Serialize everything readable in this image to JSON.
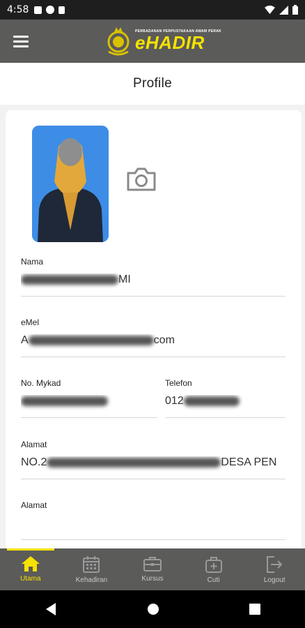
{
  "status": {
    "time": "4:58"
  },
  "header": {
    "app_name": "eHADIR",
    "tagline": "PERBADANAN PERPUSTAKAAN AWAM PERAK"
  },
  "page": {
    "title": "Profile"
  },
  "profile": {
    "fields": {
      "nama": {
        "label": "Nama",
        "value": "MI"
      },
      "emel": {
        "label": "eMel",
        "value": "A",
        "value_end": "com"
      },
      "mykad": {
        "label": "No. Mykad",
        "value": ""
      },
      "telefon": {
        "label": "Telefon",
        "value": "012"
      },
      "alamat1": {
        "label": "Alamat",
        "value": "NO.2",
        "value_end": "DESA PEN"
      },
      "alamat2": {
        "label": "Alamat",
        "value": ""
      }
    }
  },
  "nav": {
    "items": [
      {
        "label": "Utama",
        "icon": "home-icon",
        "active": true
      },
      {
        "label": "Kehadiran",
        "icon": "calendar-icon",
        "active": false
      },
      {
        "label": "Kursus",
        "icon": "briefcase-icon",
        "active": false
      },
      {
        "label": "Cuti",
        "icon": "medical-bag-icon",
        "active": false
      },
      {
        "label": "Logout",
        "icon": "logout-icon",
        "active": false
      }
    ]
  },
  "colors": {
    "accent": "#f5e200",
    "bar": "#5b5b5a"
  }
}
